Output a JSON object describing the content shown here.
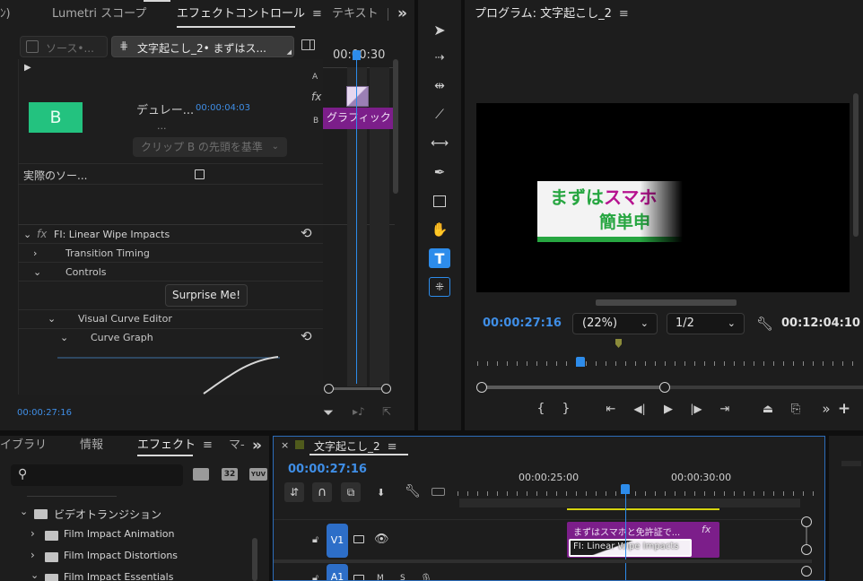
{
  "effect_controls": {
    "tabs": [
      "ﾝ)",
      "Lumetri スコープ",
      "エフェクトコントロール",
      "テキスト"
    ],
    "overflow": "»",
    "source_tab": "ソース•...",
    "clip_tab": "文字起こし_2• まずはス...",
    "clip_letter": "B",
    "duration_label": "デュレー...",
    "duration_value": "00:00:04:03",
    "ellipsis": "...",
    "align_dropdown": "クリップ B の先頭を基準",
    "actual_source_label": "実際のソー...",
    "effect_name": "FI: Linear Wipe Impacts",
    "rows": {
      "transition_timing": "Transition Timing",
      "controls": "Controls",
      "surprise_button": "Surprise Me!",
      "visual_curve_editor": "Visual Curve Editor",
      "curve_graph": "Curve Graph"
    },
    "mini_timecode": "00:00:30",
    "label_a": "A",
    "label_b": "B",
    "graphic_clip": "グラフィック",
    "fx_label": "fx",
    "current_time": "00:00:27:16"
  },
  "program_monitor": {
    "title": "プログラム: 文字起こし_2",
    "caption_line1": "まずはスマホ",
    "caption_line2": "簡単申",
    "timecode": "00:00:27:16",
    "zoom": "(22%)",
    "resolution": "1/2",
    "duration": "00:12:04:10"
  },
  "effects_panel": {
    "tabs": [
      "イブラリ",
      "情報",
      "エフェクト",
      "マ-"
    ],
    "search_placeholder": "",
    "badges": [
      "32",
      "YUV"
    ],
    "tree": {
      "parent": "ビデオトランジション",
      "items": [
        "Film Impact Animation",
        "Film Impact Distortions",
        "Film Impact Essentials"
      ]
    }
  },
  "timeline": {
    "title": "文字起こし_2",
    "timecode": "00:00:27:16",
    "ruler": [
      "00:00:25:00",
      "00:00:30:00"
    ],
    "tracks": {
      "v1": "V1",
      "a1": "A1"
    },
    "clip_name": "まずはスマホと免許証で...",
    "transition_name": "FI: Linear Wipe Impacts",
    "fx": "fx",
    "m": "M",
    "s": "S"
  },
  "colors": {
    "accent_blue": "#2d8ceb",
    "clip_green": "#23c27f",
    "graphic_purple": "#7c1e8a",
    "caption_green": "#27a641",
    "caption_magenta": "#b6128f"
  }
}
